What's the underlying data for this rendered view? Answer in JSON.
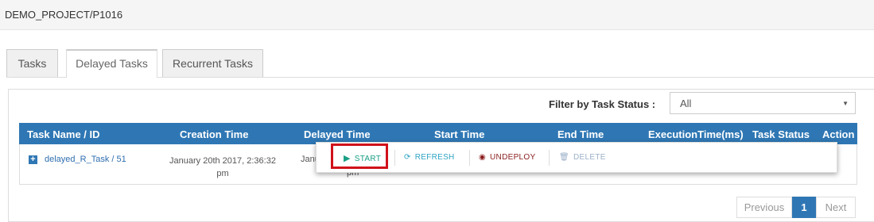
{
  "breadcrumb": "DEMO_PROJECT/P1016",
  "tabs": [
    "Tasks",
    "Delayed Tasks",
    "Recurrent Tasks"
  ],
  "active_tab": "Delayed Tasks",
  "filter": {
    "label": "Filter by Task Status :",
    "value": "All"
  },
  "table": {
    "headers": [
      "Task Name / ID",
      "Creation Time",
      "Delayed Time",
      "Start Time",
      "End Time",
      "ExecutionTime(ms)",
      "Task Status",
      "Action"
    ],
    "row": {
      "name": "delayed_R_Task / 51",
      "creation_line1": "January 20th 2017, 2:36:32",
      "creation_line2": "pm",
      "delayed_partial": "Janu",
      "delayed_partial2": "pm"
    }
  },
  "actions": {
    "start": "START",
    "refresh": "REFRESH",
    "undeploy": "UNDEPLOY",
    "delete": "DELETE"
  },
  "pagination": {
    "previous": "Previous",
    "current": "1",
    "next": "Next"
  },
  "colors": {
    "accent": "#2f77b4",
    "start": "#1a9f86",
    "undeploy": "#8b1c1c",
    "highlight": "#d0101b"
  }
}
